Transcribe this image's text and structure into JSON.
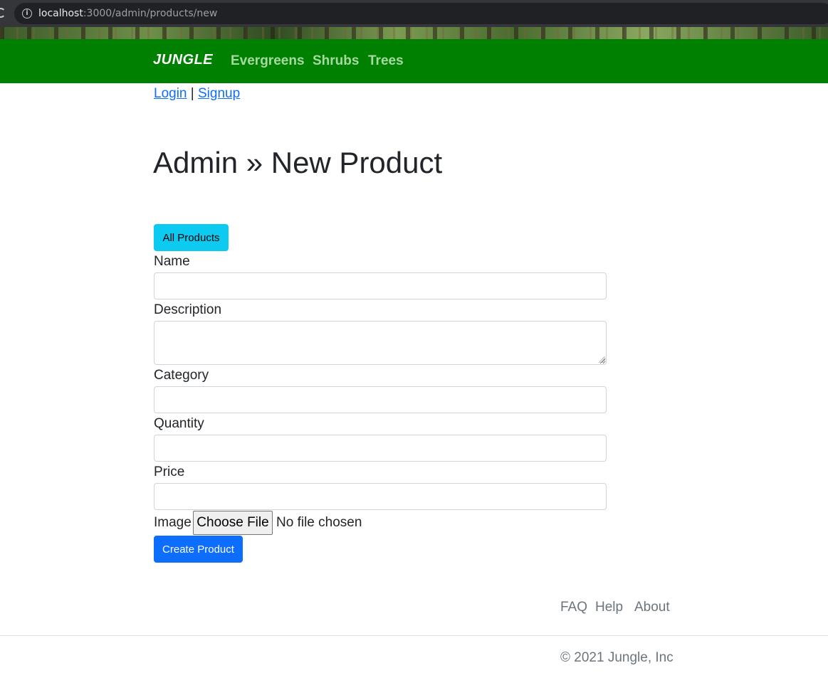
{
  "browser": {
    "url_host": "localhost",
    "url_path": ":3000/admin/products/new"
  },
  "navbar": {
    "brand": "JUNGLE",
    "links": [
      "Evergreens",
      "Shrubs",
      "Trees"
    ],
    "background": "#008000"
  },
  "auth": {
    "login": "Login",
    "separator": "|",
    "signup": "Signup"
  },
  "page": {
    "title": "Admin » New Product",
    "all_products_button": "All Products"
  },
  "form": {
    "name_label": "Name",
    "description_label": "Description",
    "category_label": "Category",
    "quantity_label": "Quantity",
    "price_label": "Price",
    "image_label": "Image",
    "choose_file_button": "Choose File",
    "file_status": "No file chosen",
    "submit_button": "Create Product"
  },
  "footer": {
    "links": [
      "FAQ",
      "Help",
      "About"
    ],
    "copyright": "© 2021 Jungle, Inc"
  },
  "colors": {
    "info_button": "#0dcaf0",
    "primary_button": "#0d6efd",
    "link": "#0d6efd"
  },
  "icons": {
    "reload": "reload-icon",
    "site_info": "info-icon"
  }
}
